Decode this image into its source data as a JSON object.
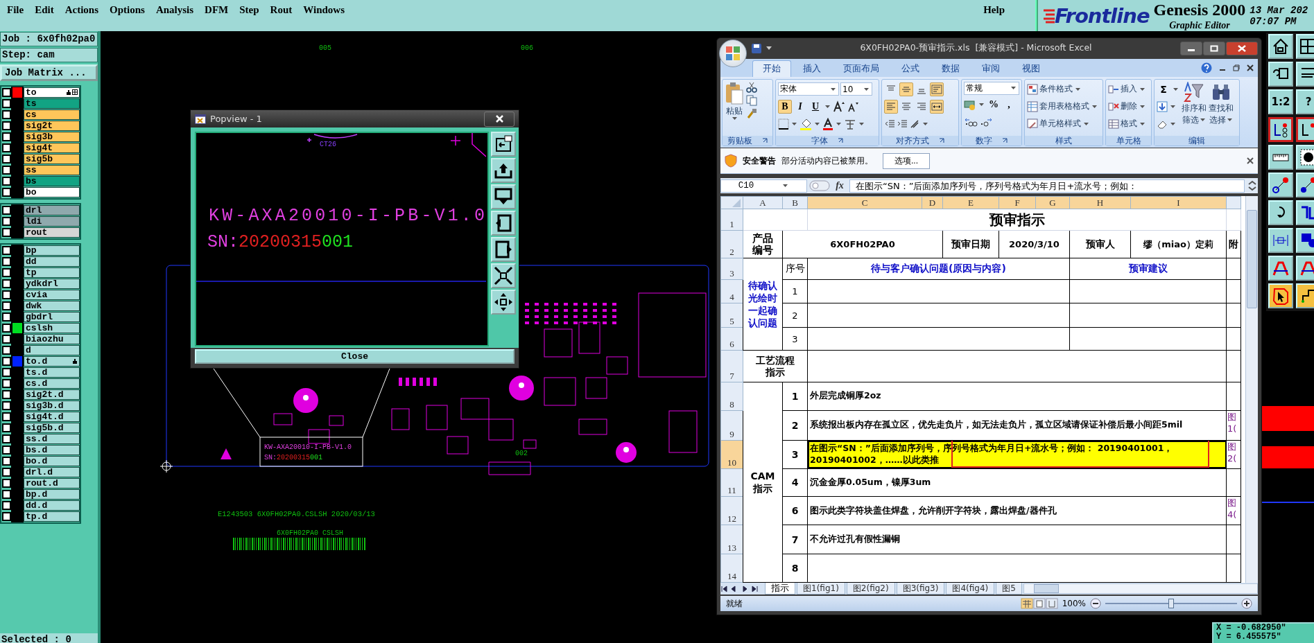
{
  "menu_bar": {
    "menus": [
      "File",
      "Edit",
      "Actions",
      "Options",
      "Analysis",
      "DFM",
      "Step",
      "Rout",
      "Windows"
    ],
    "help": "Help"
  },
  "brand": {
    "logo": "Frontline",
    "product": "Genesis 2000",
    "subtitle": "Graphic Editor",
    "date": "13 Mar 202",
    "time": "07:07 PM"
  },
  "job_panel": {
    "job": "Job : 6x0fh02pa0",
    "step": "Step: cam",
    "matrix_button": "Job Matrix ...",
    "selected_count": "Selected : 0"
  },
  "layer_groups": [
    {
      "layers": [
        {
          "name": "to",
          "color": "#ffffff",
          "swatch": {
            "color": "#ff0000"
          },
          "checked": false,
          "hand": true,
          "grid": true
        },
        {
          "name": "ts",
          "color": "#12a383",
          "checked": false,
          "hand": false,
          "grid": false
        },
        {
          "name": "cs",
          "color": "#ffc65a",
          "checked": false,
          "hand": false,
          "grid": false
        },
        {
          "name": "sig2t",
          "color": "#ffc65a",
          "checked": false,
          "hand": false,
          "grid": false
        },
        {
          "name": "sig3b",
          "color": "#ffc65a",
          "checked": false,
          "hand": false,
          "grid": false
        },
        {
          "name": "sig4t",
          "color": "#ffc65a",
          "checked": false,
          "hand": false,
          "grid": false
        },
        {
          "name": "sig5b",
          "color": "#ffc65a",
          "checked": false,
          "hand": false,
          "grid": false
        },
        {
          "name": "ss",
          "color": "#ffc65a",
          "checked": false,
          "hand": false,
          "grid": false
        },
        {
          "name": "bs",
          "color": "#12a383",
          "checked": false,
          "hand": false,
          "grid": false
        },
        {
          "name": "bo",
          "color": "#ffffff",
          "checked": false,
          "hand": false,
          "grid": false
        }
      ]
    },
    {
      "layers": [
        {
          "name": "drl",
          "color": "#8fa9ad",
          "checked": false,
          "hand": false,
          "grid": false
        },
        {
          "name": "ldi",
          "color": "#8fa9ad",
          "checked": false,
          "hand": false,
          "grid": false
        },
        {
          "name": "rout",
          "color": "#d6d6d6",
          "checked": false,
          "hand": false,
          "grid": false
        }
      ]
    },
    {
      "layers": [
        {
          "name": "bp",
          "color": "#a6dcd8",
          "checked": false,
          "hand": false,
          "grid": false
        },
        {
          "name": "dd",
          "color": "#a6dcd8",
          "checked": false,
          "hand": false,
          "grid": false
        },
        {
          "name": "tp",
          "color": "#a6dcd8",
          "checked": false,
          "hand": false,
          "grid": false
        },
        {
          "name": "ydkdrl",
          "color": "#a6dcd8",
          "checked": false,
          "hand": false,
          "grid": false
        },
        {
          "name": "cvia",
          "color": "#a6dcd8",
          "checked": false,
          "hand": false,
          "grid": false
        },
        {
          "name": "dwk",
          "color": "#a6dcd8",
          "checked": false,
          "hand": false,
          "grid": false
        },
        {
          "name": "gbdrl",
          "color": "#a6dcd8",
          "checked": false,
          "hand": false,
          "grid": false
        },
        {
          "name": "cslsh",
          "color": "#a6dcd8",
          "swatch": {
            "color": "#00dd22"
          },
          "checked": false,
          "hand": false,
          "grid": false
        },
        {
          "name": "biaozhu",
          "color": "#a6dcd8",
          "checked": false,
          "hand": false,
          "grid": false
        },
        {
          "name": "d",
          "color": "#a6dcd8",
          "checked": false,
          "hand": false,
          "grid": false
        },
        {
          "name": "to.d",
          "color": "#a6dcd8",
          "swatch": {
            "color": "#0022ff"
          },
          "checked": false,
          "hand": true,
          "grid": false
        },
        {
          "name": "ts.d",
          "color": "#a6dcd8",
          "checked": false,
          "hand": false,
          "grid": false
        },
        {
          "name": "cs.d",
          "color": "#a6dcd8",
          "checked": false,
          "hand": false,
          "grid": false
        },
        {
          "name": "sig2t.d",
          "color": "#a6dcd8",
          "checked": false,
          "hand": false,
          "grid": false
        },
        {
          "name": "sig3b.d",
          "color": "#a6dcd8",
          "checked": false,
          "hand": false,
          "grid": false
        },
        {
          "name": "sig4t.d",
          "color": "#a6dcd8",
          "checked": false,
          "hand": false,
          "grid": false
        },
        {
          "name": "sig5b.d",
          "color": "#a6dcd8",
          "checked": false,
          "hand": false,
          "grid": false
        },
        {
          "name": "ss.d",
          "color": "#a6dcd8",
          "checked": false,
          "hand": false,
          "grid": false
        },
        {
          "name": "bs.d",
          "color": "#a6dcd8",
          "checked": false,
          "hand": false,
          "grid": false
        },
        {
          "name": "bo.d",
          "color": "#a6dcd8",
          "checked": false,
          "hand": false,
          "grid": false
        },
        {
          "name": "drl.d",
          "color": "#a6dcd8",
          "checked": false,
          "hand": false,
          "grid": false
        },
        {
          "name": "rout.d",
          "color": "#a6dcd8",
          "checked": false,
          "hand": false,
          "grid": false
        },
        {
          "name": "bp.d",
          "color": "#a6dcd8",
          "checked": false,
          "hand": false,
          "grid": false
        },
        {
          "name": "dd.d",
          "color": "#a6dcd8",
          "checked": false,
          "hand": false,
          "grid": false
        },
        {
          "name": "tp.d",
          "color": "#a6dcd8",
          "checked": false,
          "hand": false,
          "grid": false
        }
      ]
    }
  ],
  "canvas": {
    "grid_labels": [
      "005",
      "006"
    ],
    "board": {
      "part_number": "KW-AXA20010-I-PB-V1.0",
      "sn_prefix": "SN:",
      "sn_date": "20200315",
      "sn_seq": "001",
      "panel_label": "002"
    },
    "footer_text": "E1243503 6X0FH02PA0.CSLSH 2020/03/13",
    "barcode_caption": "6X0FH02PA0 CSLSH"
  },
  "popview": {
    "title": "Popview - 1",
    "ref_label": "CT26",
    "part_number": "KW-AXA20010-I-PB-V1.0",
    "sn_prefix": "SN:",
    "sn_date": "20200315",
    "sn_seq": "001",
    "close_button": "Close"
  },
  "excel": {
    "title": "6X0FH02PA0-预审指示.xls  [兼容模式] - Microsoft Excel",
    "tabs": [
      {
        "label": "开始",
        "selected": true
      },
      {
        "label": "插入",
        "selected": false
      },
      {
        "label": "页面布局",
        "selected": false
      },
      {
        "label": "公式",
        "selected": false
      },
      {
        "label": "数据",
        "selected": false
      },
      {
        "label": "审阅",
        "selected": false
      },
      {
        "label": "视图",
        "selected": false
      }
    ],
    "ribbon": {
      "clipboard": {
        "label": "剪贴板",
        "paste": "粘贴"
      },
      "font": {
        "label": "字体",
        "face": "宋体",
        "size": "10",
        "bold": {
          "glyph": "B",
          "on": true
        },
        "italic": {
          "glyph": "I",
          "on": false
        },
        "underline": {
          "glyph": "U",
          "on": false
        }
      },
      "alignment": {
        "label": "对齐方式",
        "buttons": [
          {
            "on": false
          },
          {
            "on": true
          },
          {
            "on": false
          },
          {
            "on": true
          },
          {
            "on": true
          },
          {
            "on": false
          },
          {
            "on": false
          },
          {
            "on": true
          }
        ]
      },
      "number": {
        "label": "数字",
        "format": "常规",
        "percent": "%",
        "comma": ","
      },
      "styles": {
        "label": "样式",
        "items": [
          "条件格式",
          "套用表格格式",
          "单元格样式"
        ]
      },
      "cells": {
        "label": "单元格",
        "items": [
          "插入",
          "删除",
          "格式"
        ]
      },
      "editing": {
        "label": "编辑",
        "sum": "Σ",
        "sort": [
          "排序和",
          "筛选"
        ],
        "find": [
          "查找和",
          "选择"
        ]
      }
    },
    "security_bar": {
      "title": "安全警告",
      "message": "部分活动内容已被禁用。",
      "button": "选项..."
    },
    "formula_bar": {
      "cell": "C10",
      "function_label": "fx",
      "content": "在图示“SN：”后面添加序列号，序列号格式为年月日+流水号；例如："
    },
    "columns": [
      {
        "label": "A",
        "selected": false
      },
      {
        "label": "B",
        "selected": false
      },
      {
        "label": "C",
        "selected": true
      },
      {
        "label": "D",
        "selected": true
      },
      {
        "label": "E",
        "selected": true
      },
      {
        "label": "F",
        "selected": true
      },
      {
        "label": "G",
        "selected": true
      },
      {
        "label": "H",
        "selected": true
      },
      {
        "label": "I",
        "selected": true
      }
    ],
    "rows": [
      {
        "label": "1",
        "selected": false
      },
      {
        "label": "2",
        "selected": false
      },
      {
        "label": "3",
        "selected": false
      },
      {
        "label": "4",
        "selected": false
      },
      {
        "label": "5",
        "selected": false
      },
      {
        "label": "6",
        "selected": false
      },
      {
        "label": "7",
        "selected": false
      },
      {
        "label": "8",
        "selected": false
      },
      {
        "label": "9",
        "selected": false
      },
      {
        "label": "10",
        "selected": true
      },
      {
        "label": "11",
        "selected": false
      },
      {
        "label": "12",
        "selected": false
      },
      {
        "label": "13",
        "selected": false
      },
      {
        "label": "14",
        "selected": false
      }
    ],
    "sheet": {
      "title": "预审指示",
      "product_label": "产品编号",
      "product_code": "6X0FH02PA0",
      "date_label": "预审日期",
      "date": "2020/3/10",
      "reviewer_label": "预审人",
      "reviewer": "缪（miao）定莉",
      "attachment_label": "附",
      "pending": {
        "label": "待确认光绘时一起确认问题",
        "index_header": "序号",
        "question_header": "待与客户确认问题(原因与内容)",
        "advice_header": "预审建议",
        "rows": [
          {
            "index": "1"
          },
          {
            "index": "2"
          },
          {
            "index": "3"
          }
        ]
      },
      "process_label": "工艺流程指示",
      "cam": {
        "label": "CAM指示",
        "rows": [
          {
            "index": "1",
            "text": "外层完成铜厚2oz",
            "highlighted": false,
            "selected": false,
            "annotated": false
          },
          {
            "index": "2",
            "text": "系统报出板内存在孤立区，优先走负片，如无法走负片，孤立区域请保证补偿后最小间距5mil",
            "link": "图1(",
            "highlighted": false,
            "selected": false,
            "annotated": false
          },
          {
            "index": "3",
            "text": "在图示“SN：”后面添加序列号，序列号格式为年月日+流水号；例如： 20190401001，20190401002，……以此类推",
            "link": "图2(",
            "highlighted": true,
            "selected": true,
            "annotated": true
          },
          {
            "index": "4",
            "text": "沉金金厚0.05um，镍厚3um",
            "highlighted": false,
            "selected": false,
            "annotated": false
          },
          {
            "index": "6",
            "text": "图示此类字符块盖住焊盘，允许削开字符块，露出焊盘/器件孔",
            "link": "图4(",
            "highlighted": false,
            "selected": false,
            "annotated": false
          },
          {
            "index": "7",
            "text": "不允许过孔有假性漏铜",
            "highlighted": false,
            "selected": false,
            "annotated": false
          },
          {
            "index": "8",
            "highlighted": false,
            "selected": false,
            "annotated": false
          }
        ]
      }
    },
    "sheet_tabs": [
      {
        "label": "指示",
        "selected": true
      },
      {
        "label": "图1(fig1)",
        "selected": false
      },
      {
        "label": "图2(fig2)",
        "selected": false
      },
      {
        "label": "图3(fig3)",
        "selected": false
      },
      {
        "label": "图4(fig4)",
        "selected": false
      },
      {
        "label": "图5",
        "selected": false
      }
    ],
    "status_bar": {
      "text": "就绪",
      "zoom": {
        "label": "100%",
        "level": 0.5
      }
    }
  },
  "palette": {
    "glyphs": [
      "1:2",
      "?"
    ]
  },
  "coordinates": {
    "x": "X = -0.682950\"",
    "y": "Y = 6.455575\""
  }
}
